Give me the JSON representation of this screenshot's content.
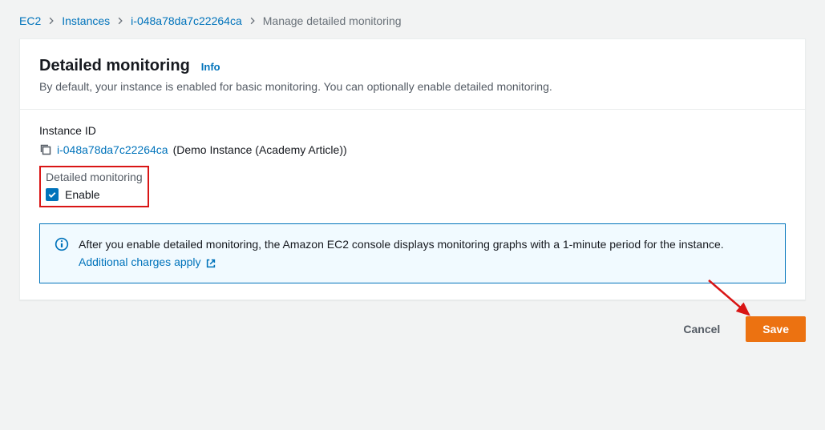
{
  "breadcrumb": {
    "items": [
      {
        "label": "EC2",
        "link": true
      },
      {
        "label": "Instances",
        "link": true
      },
      {
        "label": "i-048a78da7c22264ca",
        "link": true
      },
      {
        "label": "Manage detailed monitoring",
        "link": false
      }
    ]
  },
  "header": {
    "title": "Detailed monitoring",
    "info": "Info",
    "subtitle": "By default, your instance is enabled for basic monitoring. You can optionally enable detailed monitoring."
  },
  "body": {
    "instance_id_label": "Instance ID",
    "instance_id": "i-048a78da7c22264ca",
    "instance_name": "(Demo Instance (Academy Article))",
    "detailed_monitoring_label": "Detailed monitoring",
    "enable_label": "Enable",
    "enable_checked": true
  },
  "alert": {
    "text_prefix": "After you enable detailed monitoring, the Amazon EC2 console displays monitoring graphs with a 1-minute period for the instance. ",
    "link_text": "Additional charges apply"
  },
  "footer": {
    "cancel": "Cancel",
    "save": "Save"
  }
}
